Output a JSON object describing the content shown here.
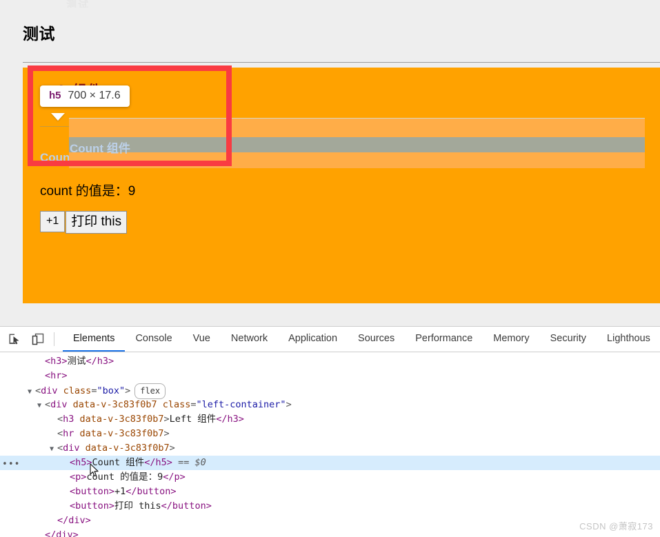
{
  "page": {
    "ghost_text": "测试",
    "title": "测试",
    "left_container": {
      "heading": "Left 组件",
      "count_heading": "Count 组件",
      "count_paragraph": "count 的值是：9",
      "buttons": [
        {
          "label": "+1"
        },
        {
          "label": "打印 this"
        }
      ]
    }
  },
  "highlight": {
    "label": "Count 组件",
    "margin_color": "#ffad48",
    "content_color": "#a3a89a",
    "box_color": "#ffa200"
  },
  "tooltip": {
    "tag": "h5",
    "dimensions": "700 × 17.6"
  },
  "annotation": {
    "rect_color": "#f93b42"
  },
  "devtools": {
    "icons": [
      {
        "name": "inspect-element-icon",
        "title": "Inspect"
      },
      {
        "name": "device-toolbar-icon",
        "title": "Toggle device toolbar"
      }
    ],
    "tabs": [
      {
        "label": "Elements",
        "active": true
      },
      {
        "label": "Console",
        "active": false
      },
      {
        "label": "Vue",
        "active": false
      },
      {
        "label": "Network",
        "active": false
      },
      {
        "label": "Application",
        "active": false
      },
      {
        "label": "Sources",
        "active": false
      },
      {
        "label": "Performance",
        "active": false
      },
      {
        "label": "Memory",
        "active": false
      },
      {
        "label": "Security",
        "active": false
      },
      {
        "label": "Lighthous",
        "active": false
      }
    ],
    "dom": {
      "row1": {
        "open": "<h3>",
        "text": "测试",
        "close": "</h3>"
      },
      "row2": {
        "tag": "<hr>"
      },
      "row3": {
        "lt": "<",
        "tag": "div",
        "attr": "class",
        "eq": "=",
        "val": "\"box\"",
        "gt": ">",
        "badge": "flex"
      },
      "row4": {
        "lt": "<",
        "tag": "div",
        "attr1": "data-v-3c83f0b7",
        "attr2": "class",
        "eq": "=",
        "val": "\"left-container\"",
        "gt": ">"
      },
      "row5": {
        "lt": "<",
        "tag": "h3",
        "attr1": "data-v-3c83f0b7",
        "gt": ">",
        "text": "Left 组件",
        "close": "</h3>"
      },
      "row6": {
        "lt": "<",
        "tag": "hr",
        "attr1": "data-v-3c83f0b7",
        "gt": ">"
      },
      "row7": {
        "lt": "<",
        "tag": "div",
        "attr1": "data-v-3c83f0b7",
        "gt": ">"
      },
      "row8": {
        "open": "<h5>",
        "text": "Count 组件",
        "close": "</h5>",
        "eqeq": "==",
        "ref": "$0"
      },
      "row9": {
        "open": "<p>",
        "text": "count 的值是：9",
        "close": "</p>"
      },
      "row10": {
        "open": "<button>",
        "text": "+1",
        "close": "</button>"
      },
      "row11": {
        "open": "<button>",
        "text": "打印 this",
        "close": "</button>"
      },
      "row12": {
        "close": "</div>"
      },
      "row13": {
        "close": "</div>"
      }
    }
  },
  "watermark": {
    "text": "CSDN @萧寂173"
  }
}
